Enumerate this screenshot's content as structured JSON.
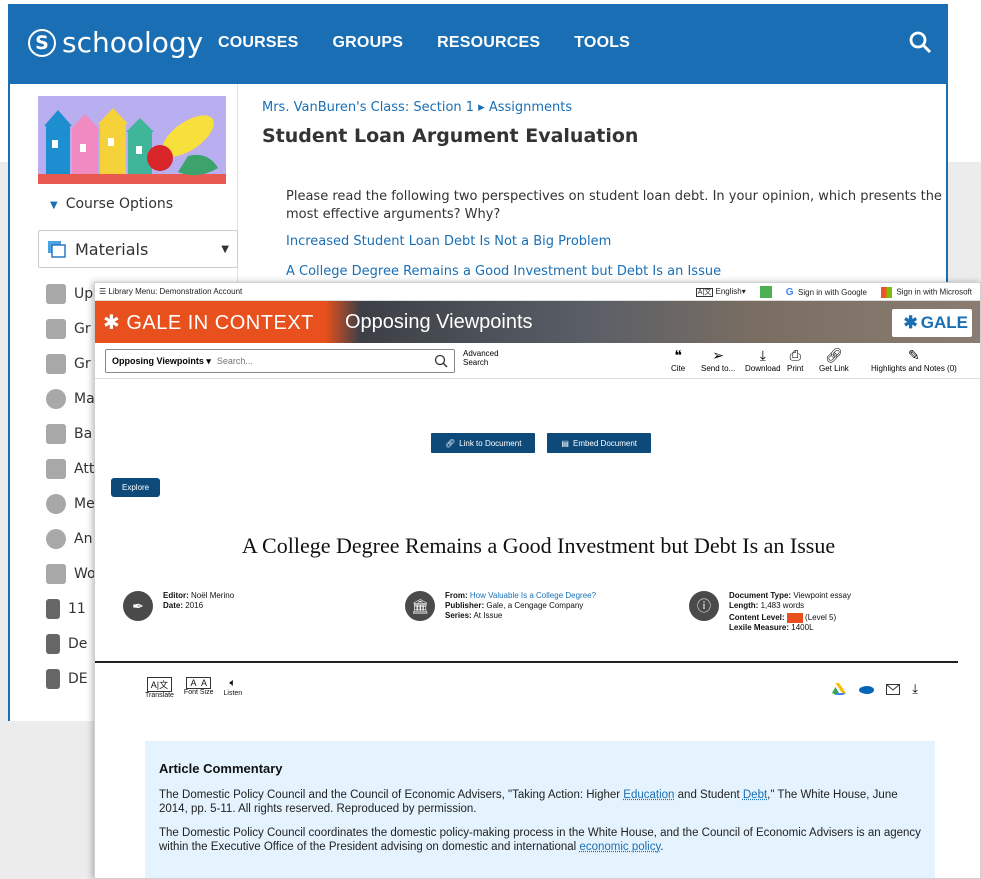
{
  "schoology": {
    "logo": "schoology",
    "logo_mark": "S",
    "nav": [
      "COURSES",
      "GROUPS",
      "RESOURCES",
      "TOOLS"
    ],
    "course_options": "Course Options",
    "materials": "Materials",
    "side_items": [
      "Up",
      "Gr",
      "Gr",
      "Ma",
      "Ba",
      "Att",
      "Me",
      "An",
      "Wo",
      "11",
      "De",
      "DE"
    ],
    "breadcrumb": "Mrs. VanBuren's Class: Section 1 ▸ Assignments",
    "title": "Student Loan Argument Evaluation",
    "instructions": "Please read the following two perspectives on student loan debt. In your opinion, which presents the most effective arguments? Why?",
    "links": [
      "Increased Student Loan Debt Is Not a Big Problem",
      "A College Degree Remains a Good Investment but Debt Is an Issue"
    ]
  },
  "gale": {
    "library_menu": "☰ Library Menu: Demonstration Account",
    "language": "English▾",
    "sign_google": "Sign in with Google",
    "sign_microsoft": "Sign in with Microsoft",
    "brand": "GALE IN CONTEXT",
    "product": "Opposing Viewpoints",
    "gale_logo": "GALE",
    "search_scope": "Opposing Viewpoints ▾",
    "search_placeholder": "Search...",
    "advanced_1": "Advanced",
    "advanced_2": "Search",
    "tools": [
      "Cite",
      "Send to...",
      "Download",
      "Print",
      "Get Link",
      "Highlights and Notes (0)"
    ],
    "link_btn": "Link to Document",
    "embed_btn": "Embed Document",
    "explore": "Explore",
    "doc_title": "A College Degree Remains a Good Investment but Debt Is an Issue",
    "meta": {
      "editor_label": "Editor:",
      "editor": "Noël Merino",
      "date_label": "Date:",
      "date": "2016",
      "from_label": "From:",
      "from": "How Valuable Is a College Degree?",
      "publisher_label": "Publisher:",
      "publisher": "Gale, a Cengage Company",
      "series_label": "Series:",
      "series": "At Issue",
      "type_label": "Document Type:",
      "type": "Viewpoint essay",
      "length_label": "Length:",
      "length": "1,483 words",
      "level_label": "Content Level:",
      "level": "(Level 5)",
      "lexile_label": "Lexile Measure:",
      "lexile": "1400L"
    },
    "translate": "Translate",
    "font_size": "Font Size",
    "listen": "Listen",
    "commentary_title": "Article Commentary",
    "para1_a": "The Domestic Policy Council and the Council of Economic Advisers, \"Taking Action: Higher ",
    "para1_link1": "Education",
    "para1_b": " and Student ",
    "para1_link2": "Debt",
    "para1_c": ",\" The White House, June 2014, pp. 5-11. All rights reserved. Reproduced by permission.",
    "para2_a": "The Domestic Policy Council coordinates the domestic policy-making process in the White House, and the Council of Economic Advisers is an agency within the Executive Office of the President advising on domestic and international ",
    "para2_link": "economic policy",
    "para2_b": "."
  },
  "colors": {
    "schoology_blue": "#1a6fb4",
    "gale_orange": "#e8501d",
    "gale_navy": "#0d4a7a"
  }
}
